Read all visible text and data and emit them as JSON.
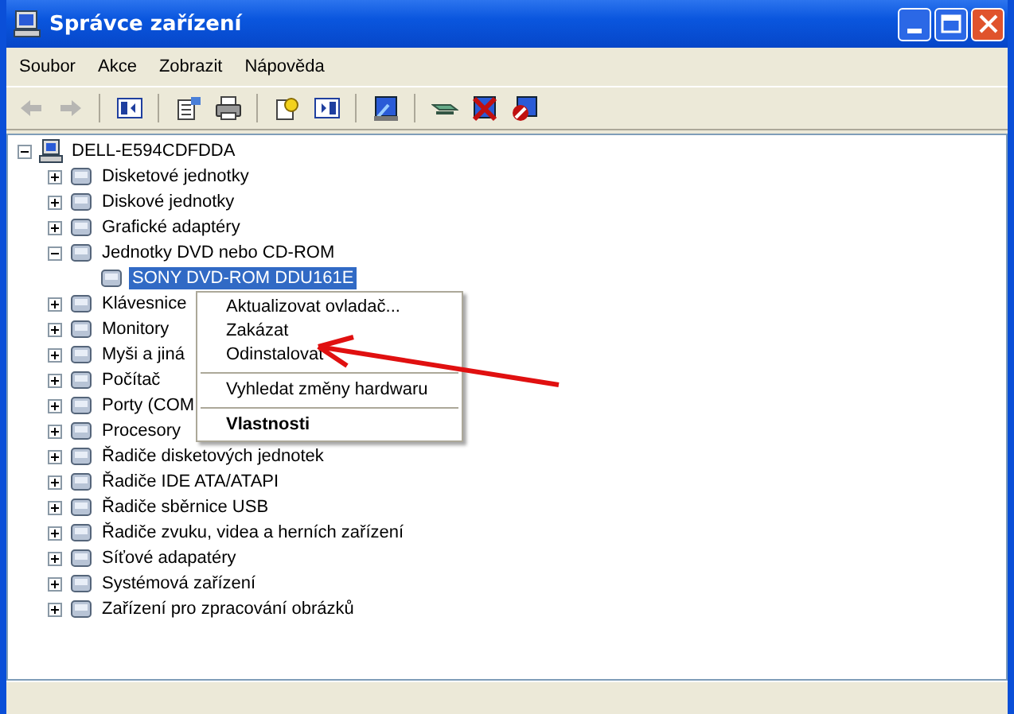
{
  "window": {
    "title": "Správce zařízení"
  },
  "menu_bar": [
    "Soubor",
    "Akce",
    "Zobrazit",
    "Nápověda"
  ],
  "toolbar": [
    {
      "disabled": true
    },
    {
      "disabled": true
    },
    {
      "disabled": false
    },
    {
      "disabled": false
    },
    {
      "disabled": false
    },
    {
      "disabled": false
    },
    {
      "disabled": false
    },
    {
      "disabled": false
    },
    {
      "disabled": false
    },
    {
      "disabled": false
    },
    {
      "disabled": false
    }
  ],
  "tree": {
    "label": "DELL-E594CDFDDA",
    "expanded": true,
    "children": [
      {
        "label": "Disketové jednotky",
        "expanded": false,
        "selected": false
      },
      {
        "label": "Diskové jednotky",
        "expanded": false,
        "selected": false
      },
      {
        "label": "Grafické adaptéry",
        "expanded": false,
        "selected": false
      },
      {
        "label": "Jednotky DVD nebo CD-ROM",
        "expanded": true,
        "selected": false,
        "children": [
          {
            "label": "SONY DVD-ROM DDU161E",
            "selected": true
          }
        ]
      },
      {
        "label": "Klávesnice",
        "expanded": false,
        "selected": false
      },
      {
        "label": "Monitory",
        "expanded": false,
        "selected": false
      },
      {
        "label": "Myši a jiná",
        "expanded": false,
        "selected": false
      },
      {
        "label": "Počítač",
        "expanded": false,
        "selected": false
      },
      {
        "label": "Porty (COM",
        "expanded": false,
        "selected": false
      },
      {
        "label": "Procesory",
        "expanded": false,
        "selected": false
      },
      {
        "label": "Řadiče disketových jednotek",
        "expanded": false,
        "selected": false
      },
      {
        "label": "Řadiče IDE ATA/ATAPI",
        "expanded": false,
        "selected": false
      },
      {
        "label": "Řadiče sběrnice USB",
        "expanded": false,
        "selected": false
      },
      {
        "label": "Řadiče zvuku, videa a herních zařízení",
        "expanded": false,
        "selected": false
      },
      {
        "label": "Síťové adapatéry",
        "expanded": false,
        "selected": false
      },
      {
        "label": "Systémová zařízení",
        "expanded": false,
        "selected": false
      },
      {
        "label": "Zařízení pro zpracování obrázků",
        "expanded": false,
        "selected": false
      }
    ]
  },
  "context_menu": [
    {
      "kind": "item",
      "label": "Aktualizovat ovladač...",
      "bold": false
    },
    {
      "kind": "item",
      "label": "Zakázat",
      "bold": false
    },
    {
      "kind": "item",
      "label": "Odinstalovat",
      "bold": false
    },
    {
      "kind": "separator"
    },
    {
      "kind": "item",
      "label": "Vyhledat změny hardwaru",
      "bold": false
    },
    {
      "kind": "separator"
    },
    {
      "kind": "item",
      "label": "Vlastnosti",
      "bold": true
    }
  ]
}
